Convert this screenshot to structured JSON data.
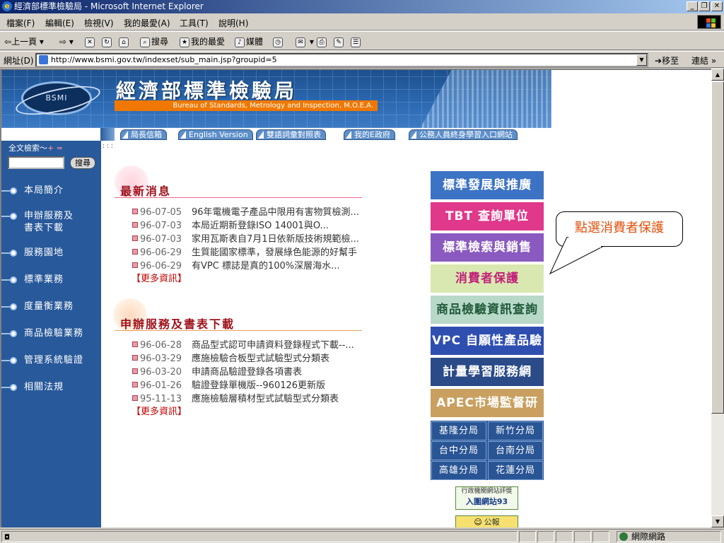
{
  "window": {
    "title": "經濟部標準檢驗局 - Microsoft Internet Explorer"
  },
  "menu": [
    "檔案(F)",
    "編輯(E)",
    "檢視(V)",
    "我的最愛(A)",
    "工具(T)",
    "說明(H)"
  ],
  "toolbar": {
    "back": "上一頁",
    "search": "搜尋",
    "favorites": "我的最愛",
    "media": "媒體"
  },
  "address": {
    "label": "網址(D)",
    "url": "http://www.bsmi.gov.tw/indexset/sub_main.jsp?groupid=5",
    "go": "移至",
    "links": "連結"
  },
  "banner": {
    "logo_text": "BSMI",
    "title_cn": "經濟部標準檢驗局",
    "title_en": "Bureau of Standards, Metrology and Inspection, M.O.E.A."
  },
  "topnav": [
    "局長信箱",
    "English Version",
    "雙語詞彙對照表",
    "我的E政府",
    "公務人員終身學習入口網站"
  ],
  "search": {
    "label": "全文檢索～",
    "label_extra": "+ =",
    "button": "搜尋"
  },
  "sidebar": [
    {
      "label": "本局簡介"
    },
    {
      "label": "申辦服務及\n書表下載"
    },
    {
      "label": "服務園地"
    },
    {
      "label": "標準業務"
    },
    {
      "label": "度量衡業務"
    },
    {
      "label": "商品檢驗業務"
    },
    {
      "label": "管理系統驗證"
    },
    {
      "label": "相關法規"
    }
  ],
  "news": {
    "title": "最新消息",
    "items": [
      {
        "date": "96-07-05",
        "text": "96年電機電子產品中限用有害物質檢測..."
      },
      {
        "date": "96-07-03",
        "text": "本局近期新登錄ISO 14001與O..."
      },
      {
        "date": "96-07-03",
        "text": "家用瓦斯表自7月1日依新版技術規範檢..."
      },
      {
        "date": "96-06-29",
        "text": "生質能國家標準，發展綠色能源的好幫手"
      },
      {
        "date": "96-06-29",
        "text": "有VPC 標誌是真的100%深層海水..."
      }
    ],
    "more": "【更多資訊】"
  },
  "forms": {
    "title": "申辦服務及書表下載",
    "items": [
      {
        "date": "96-06-28",
        "text": "商品型式認可申請資料登錄程式下載--..."
      },
      {
        "date": "96-03-29",
        "text": "應施檢驗合板型式試驗型式分類表"
      },
      {
        "date": "96-03-20",
        "text": "申請商品驗證登錄各項書表"
      },
      {
        "date": "96-01-26",
        "text": "驗證登錄單機版--960126更新版"
      },
      {
        "date": "95-11-13",
        "text": "應施檢驗層積材型式試驗型式分類表"
      }
    ],
    "more": "【更多資訊】"
  },
  "right_buttons": [
    {
      "label": "標準發展與推廣",
      "bg": "#3d73c4",
      "fg": "#ffffff"
    },
    {
      "label": "TBT 查詢單位",
      "bg": "#e0388a",
      "fg": "#ffffff"
    },
    {
      "label": "標準檢索與銷售",
      "bg": "#8a5ac0",
      "fg": "#ffffff"
    },
    {
      "label": "消費者保護",
      "bg": "#d9e8b0",
      "fg": "#c2207a"
    },
    {
      "label": "商品檢驗資訊查詢",
      "bg": "#b8d8c8",
      "fg": "#1f5a3a"
    },
    {
      "label": "VPC 自願性產品驗證",
      "bg": "#2f4fb0",
      "fg": "#ffffff"
    },
    {
      "label": "計量學習服務網",
      "bg": "#2a4a88",
      "fg": "#ffffff"
    },
    {
      "label": "APEC市場監督研討會",
      "bg": "#c9a060",
      "fg": "#ffffff"
    }
  ],
  "branches": [
    "基隆分局",
    "新竹分局",
    "台中分局",
    "台南分局",
    "高雄分局",
    "花蓮分局"
  ],
  "callout": "點選消費者保護",
  "badges": [
    {
      "top": "行政機關網站評獎",
      "bottom": "入圍網站93"
    },
    {
      "top": "",
      "bottom": "公報"
    }
  ],
  "status": {
    "zone": "網際網路"
  }
}
